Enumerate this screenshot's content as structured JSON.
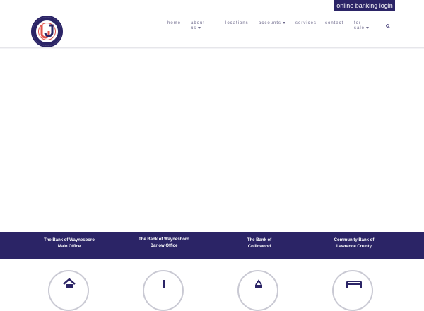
{
  "header": {
    "login_label": "online banking login",
    "logo_text": "BJ"
  },
  "nav": {
    "items": [
      {
        "label": "home",
        "caret": false
      },
      {
        "label": "about us",
        "caret": true
      },
      {
        "label": "locations",
        "caret": false
      },
      {
        "label": "accounts",
        "caret": true
      },
      {
        "label": "services",
        "caret": false
      },
      {
        "label": "contact",
        "caret": false
      },
      {
        "label": "for sale",
        "caret": true
      }
    ],
    "search_icon": "search-icon"
  },
  "branches": [
    {
      "line1": "The Bank of Waynesboro",
      "line2": "Main Office"
    },
    {
      "line1": "The Bank of Waynesboro",
      "line2": "Barlow Office"
    },
    {
      "line1": "The Bank of",
      "line2": "Collinwood"
    },
    {
      "line1": "Community Bank of",
      "line2": "Lawrence County"
    }
  ],
  "service_icons": [
    "home-icon",
    "bank-icon",
    "lock-icon",
    "card-icon"
  ],
  "colors": {
    "brand": "#2b2466",
    "nav_text": "#6e6a8c",
    "logo_red": "#e0524a"
  }
}
